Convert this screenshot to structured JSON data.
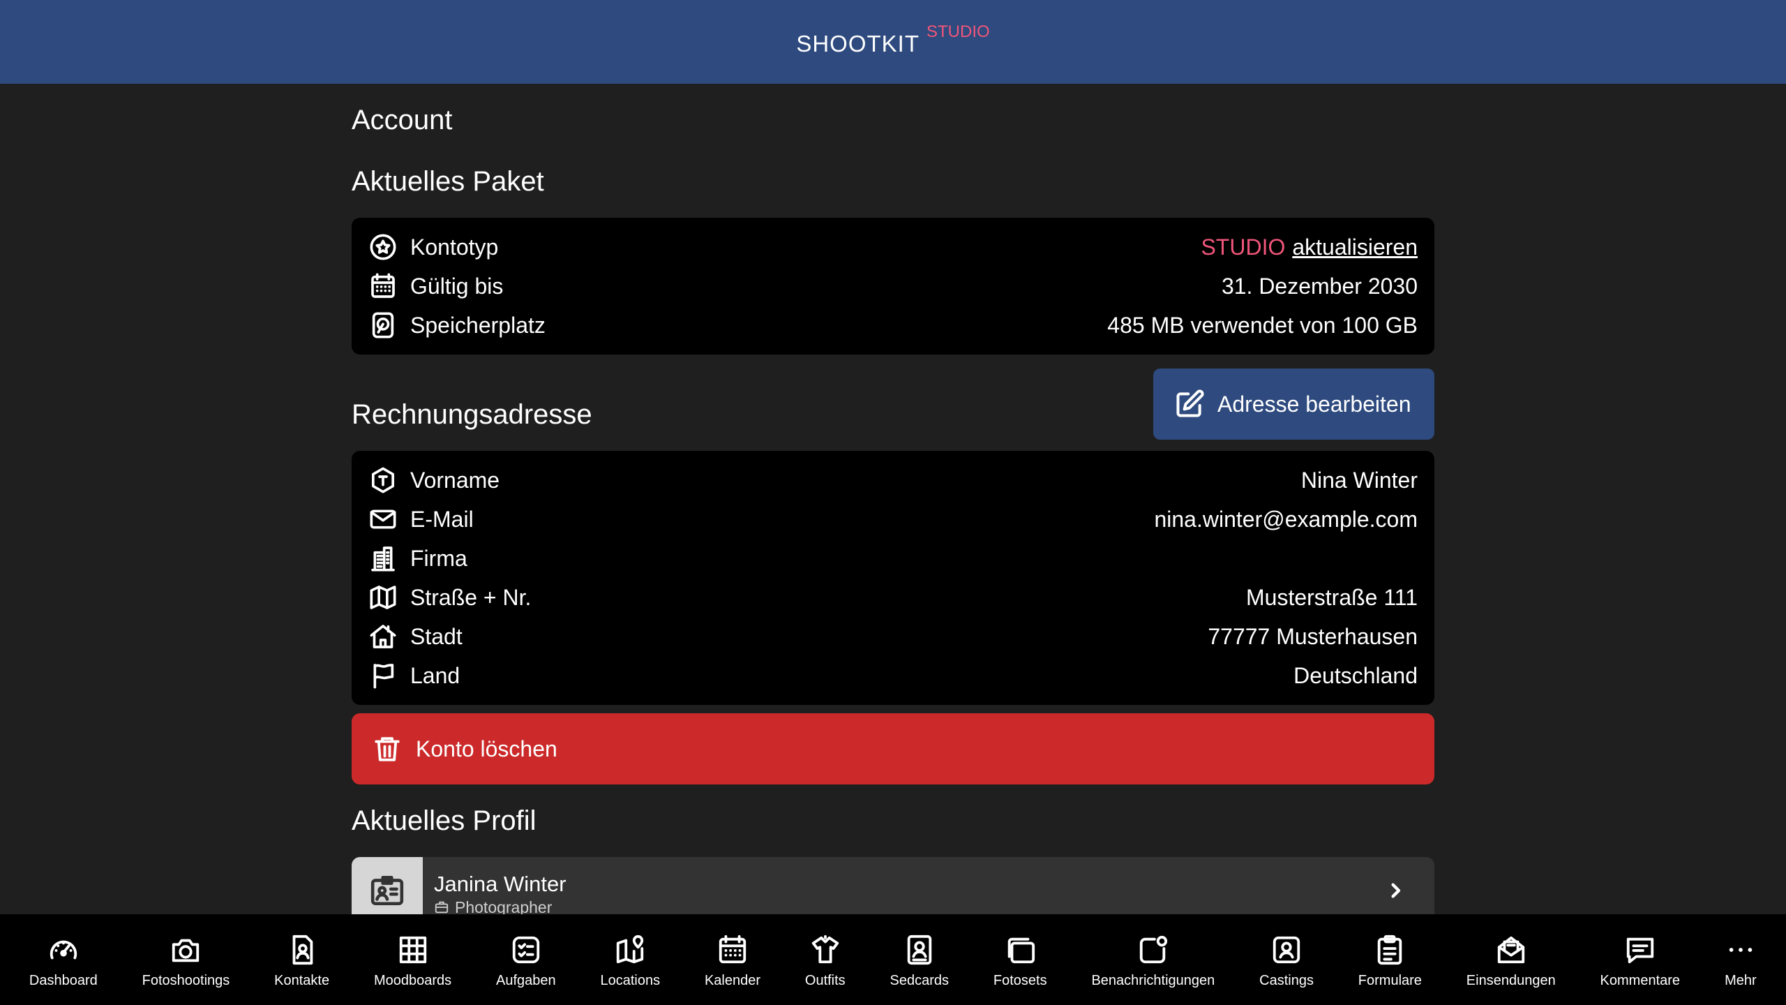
{
  "header": {
    "brand": "SHOOTKIT",
    "edition": "STUDIO"
  },
  "page": {
    "title": "Account"
  },
  "package": {
    "title": "Aktuelles Paket",
    "account_type_label": "Kontotyp",
    "account_type_value": "STUDIO",
    "upgrade_label": "aktualisieren",
    "valid_label": "Gültig bis",
    "valid_value": "31. Dezember 2030",
    "storage_label": "Speicherplatz",
    "storage_value": "485 MB verwendet von 100 GB"
  },
  "billing": {
    "title": "Rechnungsadresse",
    "edit_label": "Adresse bearbeiten",
    "rows": [
      {
        "icon": "name-icon",
        "label": "Vorname",
        "value": "Nina Winter"
      },
      {
        "icon": "mail-icon",
        "label": "E-Mail",
        "value": "nina.winter@example.com"
      },
      {
        "icon": "building-icon",
        "label": "Firma",
        "value": ""
      },
      {
        "icon": "map-icon",
        "label": "Straße + Nr.",
        "value": "Musterstraße 111"
      },
      {
        "icon": "home-icon",
        "label": "Stadt",
        "value": "77777 Musterhausen"
      },
      {
        "icon": "flag-icon",
        "label": "Land",
        "value": "Deutschland"
      }
    ]
  },
  "delete": {
    "label": "Konto löschen"
  },
  "profile": {
    "title": "Aktuelles Profil",
    "name": "Janina Winter",
    "role": "Photographer"
  },
  "tabs": [
    {
      "icon": "dashboard-icon",
      "label": "Dashboard"
    },
    {
      "icon": "camera-icon",
      "label": "Fotoshootings"
    },
    {
      "icon": "contact-icon",
      "label": "Kontakte"
    },
    {
      "icon": "moodboard-icon",
      "label": "Moodboards"
    },
    {
      "icon": "tasks-icon",
      "label": "Aufgaben"
    },
    {
      "icon": "locations-icon",
      "label": "Locations"
    },
    {
      "icon": "calendar-icon",
      "label": "Kalender"
    },
    {
      "icon": "outfit-icon",
      "label": "Outfits"
    },
    {
      "icon": "sedcard-icon",
      "label": "Sedcards"
    },
    {
      "icon": "photoset-icon",
      "label": "Fotosets"
    },
    {
      "icon": "notification-icon",
      "label": "Benachrichtigungen"
    },
    {
      "icon": "casting-icon",
      "label": "Castings"
    },
    {
      "icon": "form-icon",
      "label": "Formulare"
    },
    {
      "icon": "submission-icon",
      "label": "Einsendungen"
    },
    {
      "icon": "comment-icon",
      "label": "Kommentare"
    },
    {
      "icon": "more-icon",
      "label": "Mehr"
    }
  ]
}
